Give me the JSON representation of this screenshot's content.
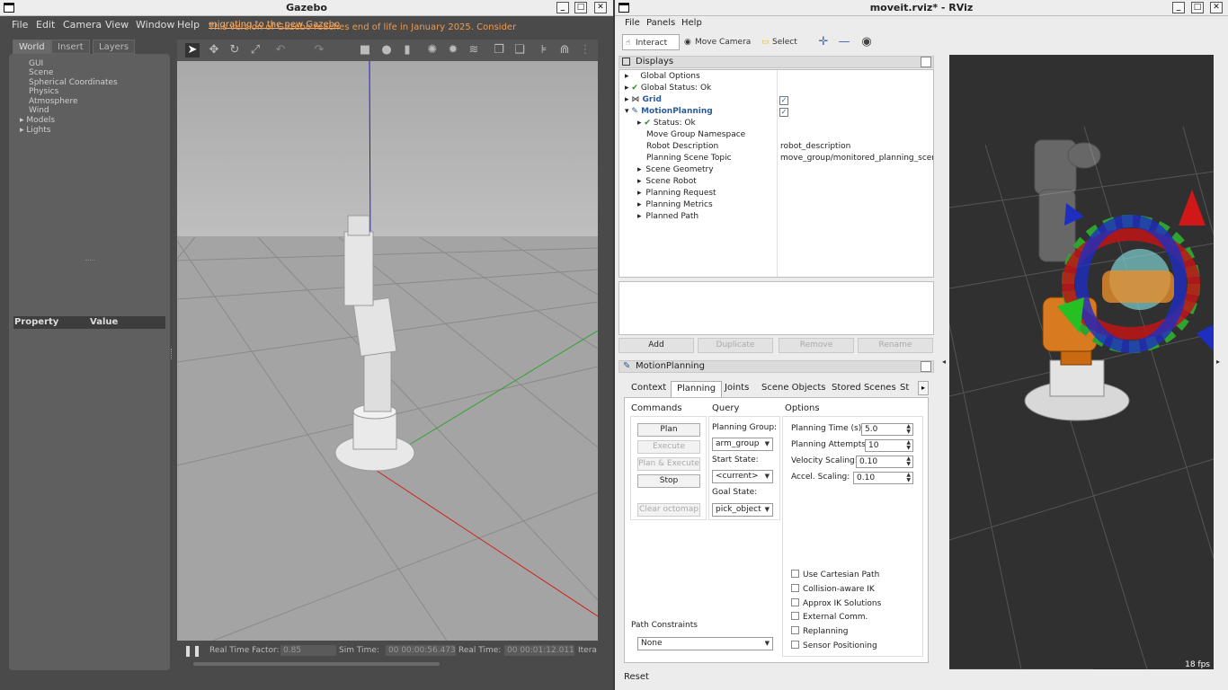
{
  "gazebo": {
    "title": "Gazebo",
    "menu": [
      "File",
      "Edit",
      "Camera",
      "View",
      "Window",
      "Help"
    ],
    "notice_prefix": "This version of Gazebo reaches end of life in January 2025. Consider ",
    "notice_link": "migrating to the new Gazebo",
    "tabs": [
      "World",
      "Insert",
      "Layers"
    ],
    "world_items": [
      "GUI",
      "Scene",
      "Spherical Coordinates",
      "Physics",
      "Atmosphere",
      "Wind",
      "Models",
      "Lights"
    ],
    "property_header": "Property",
    "value_header": "Value",
    "bottom": {
      "rtf_label": "Real Time Factor:",
      "rtf_value": "0.85",
      "sim_label": "Sim Time:",
      "sim_value": "00 00:00:56.473",
      "real_label": "Real Time:",
      "real_value": "00 00:01:12.011",
      "iter_label": "Itera"
    }
  },
  "rviz": {
    "title": "moveit.rviz* - RViz",
    "menu": [
      "File",
      "Panels",
      "Help"
    ],
    "tools": [
      "Interact",
      "Move Camera",
      "Select"
    ],
    "displays_title": "Displays",
    "tree": [
      {
        "label": "Global Options",
        "value": ""
      },
      {
        "label": "Global Status: Ok",
        "value": ""
      },
      {
        "label": "Grid",
        "value": ""
      },
      {
        "label": "MotionPlanning",
        "value": ""
      },
      {
        "label": "Status: Ok",
        "value": ""
      },
      {
        "label": "Move Group Namespace",
        "value": ""
      },
      {
        "label": "Robot Description",
        "value": "robot_description"
      },
      {
        "label": "Planning Scene Topic",
        "value": "move_group/monitored_planning_scene"
      },
      {
        "label": "Scene Geometry",
        "value": ""
      },
      {
        "label": "Scene Robot",
        "value": ""
      },
      {
        "label": "Planning Request",
        "value": ""
      },
      {
        "label": "Planning Metrics",
        "value": ""
      },
      {
        "label": "Planned Path",
        "value": ""
      }
    ],
    "display_buttons": [
      "Add",
      "Duplicate",
      "Remove",
      "Rename"
    ],
    "mp_title": "MotionPlanning",
    "mp_tabs": [
      "Context",
      "Planning",
      "Joints",
      "Scene Objects",
      "Stored Scenes",
      "St"
    ],
    "commands_title": "Commands",
    "commands": [
      "Plan",
      "Execute",
      "Plan & Execute",
      "Stop",
      "Clear octomap"
    ],
    "query_title": "Query",
    "planning_group_label": "Planning Group:",
    "planning_group_value": "arm_group",
    "start_state_label": "Start State:",
    "start_state_value": "<current>",
    "goal_state_label": "Goal State:",
    "goal_state_value": "pick_object",
    "options_title": "Options",
    "options": [
      {
        "label": "Planning Time (s):",
        "value": "5.0"
      },
      {
        "label": "Planning Attempts:",
        "value": "10"
      },
      {
        "label": "Velocity Scaling:",
        "value": "0.10"
      },
      {
        "label": "Accel. Scaling:",
        "value": "0.10"
      }
    ],
    "checkboxes": [
      "Use Cartesian Path",
      "Collision-aware IK",
      "Approx IK Solutions",
      "External Comm.",
      "Replanning",
      "Sensor Positioning"
    ],
    "path_constraints_label": "Path Constraints",
    "path_constraints_value": "None",
    "reset_label": "Reset",
    "fps": "18 fps"
  }
}
